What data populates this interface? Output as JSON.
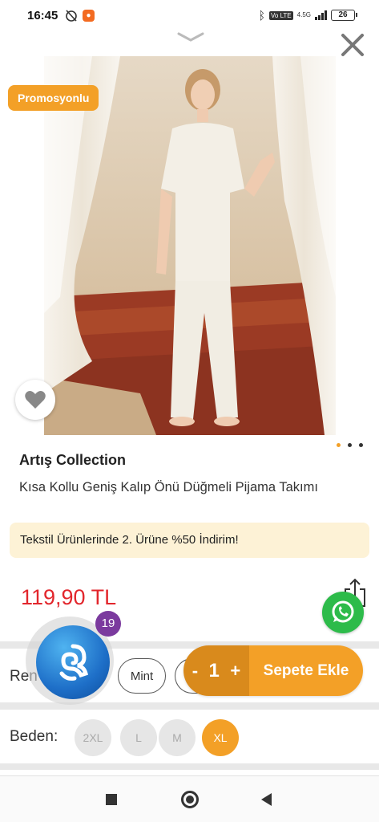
{
  "status_bar": {
    "time": "16:45",
    "network": "4.5G",
    "volte": "Vo LTE",
    "battery": "26"
  },
  "product": {
    "promo_badge": "Promosyonlu",
    "brand": "Artış Collection",
    "title": "Kısa Kollu Geniş Kalıp Önü Düğmeli Pijama Takımı",
    "campaign": "Tekstil Ürünlerinde 2. Ürüne %50 İndirim!",
    "price": "119,90 TL",
    "image_count": 3,
    "active_image": 1
  },
  "chat": {
    "unread_count": "19"
  },
  "color_selector": {
    "label": "Renk:",
    "visible_label": "Ren",
    "options": [
      "Mint"
    ]
  },
  "cart": {
    "minus": "-",
    "quantity": "1",
    "plus": "+",
    "add_label": "Sepete Ekle"
  },
  "size_selector": {
    "label": "Beden:",
    "options": [
      "2XL",
      "L",
      "M",
      "XL"
    ],
    "selected": "XL"
  },
  "colors": {
    "accent": "#f3a027",
    "price": "#e2262c",
    "whatsapp": "#2dbb4a",
    "chat_badge": "#7b3a9e"
  },
  "icons": {
    "close": "close-icon",
    "collapse": "chevron-down-icon",
    "favorite": "heart-icon",
    "share": "share-icon",
    "whatsapp": "whatsapp-icon"
  }
}
